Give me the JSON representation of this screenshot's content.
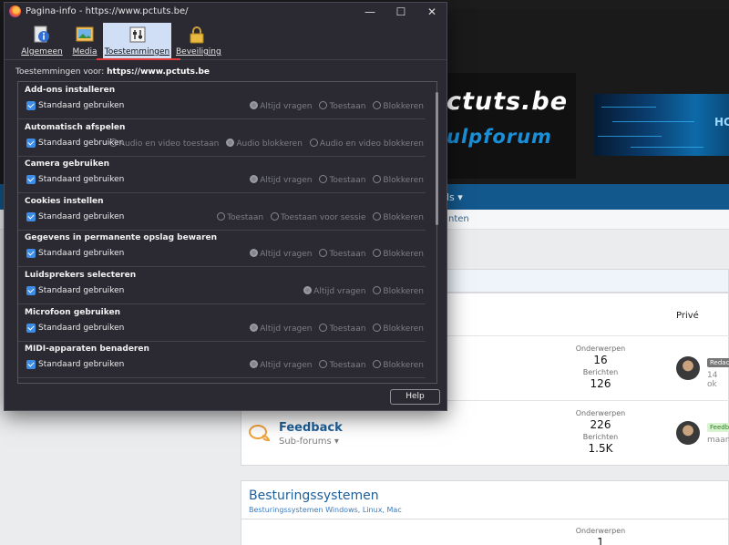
{
  "dialog": {
    "title": "Pagina-info - https://www.pctuts.be/",
    "tabs": [
      {
        "label": "Algemeen",
        "icon": "info-icon"
      },
      {
        "label": "Media",
        "icon": "media-icon"
      },
      {
        "label": "Toestemmingen",
        "icon": "permissions-icon",
        "active": true
      },
      {
        "label": "Beveiliging",
        "icon": "lock-icon"
      }
    ],
    "perm_for_label": "Toestemmingen voor:",
    "perm_for_site": "https://www.pctuts.be",
    "default_label": "Standaard gebruiken",
    "permissions": [
      {
        "title": "Add-ons installeren",
        "options": [
          "Altijd vragen",
          "Toestaan",
          "Blokkeren"
        ],
        "selected": 0
      },
      {
        "title": "Automatisch afspelen",
        "options": [
          "Audio en video toestaan",
          "Audio blokkeren",
          "Audio en video blokkeren"
        ],
        "selected": 1
      },
      {
        "title": "Camera gebruiken",
        "options": [
          "Altijd vragen",
          "Toestaan",
          "Blokkeren"
        ],
        "selected": 0
      },
      {
        "title": "Cookies instellen",
        "options": [
          "Toestaan",
          "Toestaan voor sessie",
          "Blokkeren"
        ],
        "selected": -1
      },
      {
        "title": "Gegevens in permanente opslag bewaren",
        "options": [
          "Altijd vragen",
          "Toestaan",
          "Blokkeren"
        ],
        "selected": 0
      },
      {
        "title": "Luidsprekers selecteren",
        "options": [
          "Altijd vragen",
          "Blokkeren"
        ],
        "selected": 0
      },
      {
        "title": "Microfoon gebruiken",
        "options": [
          "Altijd vragen",
          "Toestaan",
          "Blokkeren"
        ],
        "selected": 0
      },
      {
        "title": "MIDI-apparaten benaderen",
        "options": [
          "Altijd vragen",
          "Toestaan",
          "Blokkeren"
        ],
        "selected": 0
      }
    ],
    "help_label": "Help",
    "window_controls": {
      "minimize": "—",
      "maximize": "☐",
      "close": "✕"
    }
  },
  "background": {
    "logo_line1": "ctuts.be",
    "logo_line2": "ulpforum",
    "banner_text": "HC",
    "nav_label": "ls ▾",
    "subnav_label": "nten",
    "col_private": "Privé",
    "forums": [
      {
        "stats_label1": "Onderwerpen",
        "stats_value1": "16",
        "stats_label2": "Berichten",
        "stats_value2": "126",
        "tag": "Redac",
        "meta": "14 ok"
      },
      {
        "title": "Feedback",
        "sub": "Sub-forums ▾",
        "stats_label1": "Onderwerpen",
        "stats_value1": "226",
        "stats_label2": "Berichten",
        "stats_value2": "1.5K",
        "tag": "Feedb",
        "meta": "maan"
      }
    ],
    "category2_title": "Besturingssystemen",
    "category2_sub": "Besturingssystemen Windows, Linux, Mac",
    "category2_stats_label": "Onderwerpen",
    "category2_stats_value": "1"
  }
}
